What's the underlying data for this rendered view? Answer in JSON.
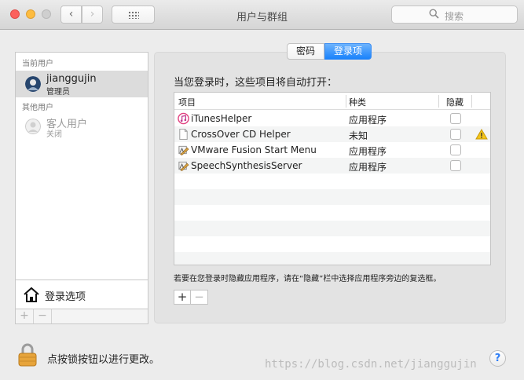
{
  "window": {
    "title": "用户与群组",
    "search_placeholder": "搜索"
  },
  "users": {
    "current_header": "当前用户",
    "current": {
      "name": "jianggujin",
      "role": "管理员"
    },
    "other_header": "其他用户",
    "guest": {
      "name": "客人用户",
      "status": "关闭"
    },
    "login_options_label": "登录选项",
    "add_label": "+",
    "remove_label": "−"
  },
  "tabs": [
    {
      "label": "密码",
      "active": false
    },
    {
      "label": "登录项",
      "active": true
    }
  ],
  "login_items": {
    "heading": "当您登录时，这些项目将自动打开：",
    "columns": {
      "item": "项目",
      "kind": "种类",
      "hide": "隐藏"
    },
    "rows": [
      {
        "name": "iTunesHelper",
        "kind": "应用程序",
        "hidden": false,
        "icon": "itunes-icon",
        "warning": false
      },
      {
        "name": "CrossOver CD Helper",
        "kind": "未知",
        "hidden": false,
        "icon": "document-icon",
        "warning": true
      },
      {
        "name": "VMware Fusion Start Menu",
        "kind": "应用程序",
        "hidden": false,
        "icon": "app-icon",
        "warning": false
      },
      {
        "name": "SpeechSynthesisServer",
        "kind": "应用程序",
        "hidden": false,
        "icon": "app-icon",
        "warning": false
      }
    ],
    "hint": "若要在您登录时隐藏应用程序，请在“隐藏”栏中选择应用程序旁边的复选框。",
    "add_label": "+",
    "remove_label": "−"
  },
  "footer": {
    "lock_text": "点按锁按钮以进行更改。",
    "help_label": "?"
  },
  "watermark": "https://blog.csdn.net/jianggujin",
  "colors": {
    "accent": "#1a82fb",
    "warning": "#f5c518"
  }
}
